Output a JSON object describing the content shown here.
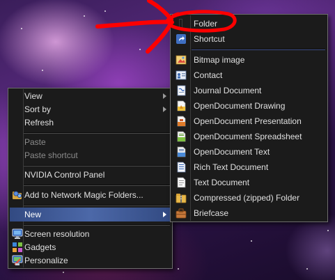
{
  "desktop_menu": {
    "items": [
      {
        "label": "View"
      },
      {
        "label": "Sort by"
      },
      {
        "label": "Refresh"
      },
      {
        "label": "Paste"
      },
      {
        "label": "Paste shortcut"
      },
      {
        "label": "NVIDIA Control Panel"
      },
      {
        "label": "Add to Network Magic Folders..."
      },
      {
        "label": "New"
      },
      {
        "label": "Screen resolution"
      },
      {
        "label": "Gadgets"
      },
      {
        "label": "Personalize"
      }
    ]
  },
  "new_submenu": {
    "items": [
      {
        "label": "Folder",
        "icon": "folder-icon"
      },
      {
        "label": "Shortcut",
        "icon": "shortcut-icon"
      },
      {
        "label": "Bitmap image",
        "icon": "bitmap-icon"
      },
      {
        "label": "Contact",
        "icon": "contact-icon"
      },
      {
        "label": "Journal Document",
        "icon": "journal-icon"
      },
      {
        "label": "OpenDocument Drawing",
        "icon": "odg-icon"
      },
      {
        "label": "OpenDocument Presentation",
        "icon": "odp-icon"
      },
      {
        "label": "OpenDocument Spreadsheet",
        "icon": "ods-icon"
      },
      {
        "label": "OpenDocument Text",
        "icon": "odt-icon"
      },
      {
        "label": "Rich Text Document",
        "icon": "rtf-icon"
      },
      {
        "label": "Text Document",
        "icon": "text-document-icon"
      },
      {
        "label": "Compressed (zipped) Folder",
        "icon": "zip-folder-icon"
      },
      {
        "label": "Briefcase",
        "icon": "briefcase-icon"
      }
    ]
  },
  "colors": {
    "menu_bg": "#1b1b1b",
    "highlight": "#4c68a8",
    "annotation": "#ff0000"
  }
}
